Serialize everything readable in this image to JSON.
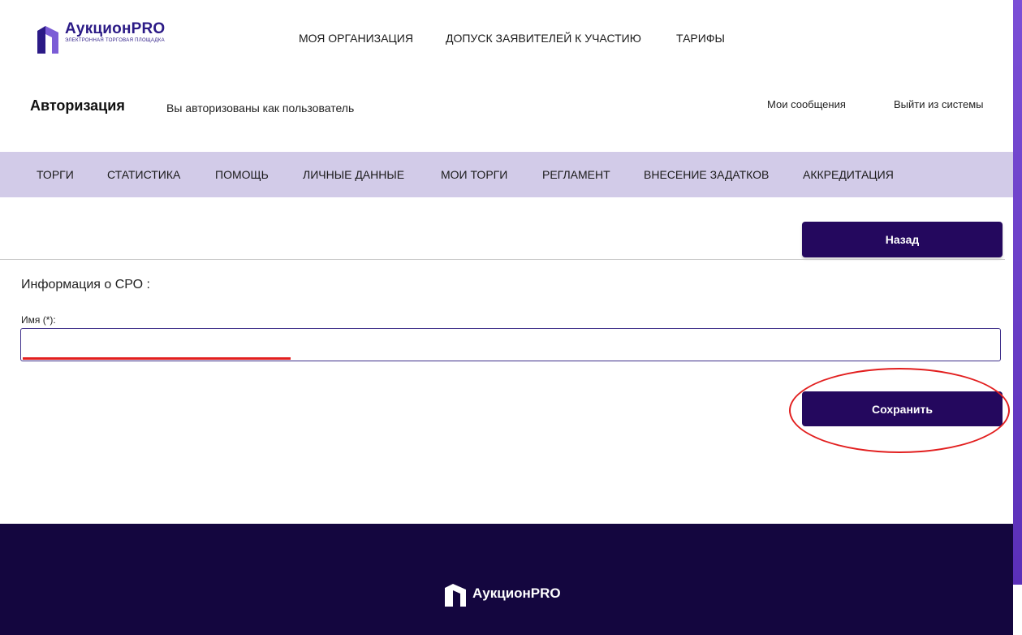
{
  "brand": {
    "name": "АукционPRO",
    "subtitle": "ЭЛЕКТРОННАЯ ТОРГОВАЯ ПЛОЩАДКА",
    "primary_color": "#24085e",
    "menu_bg_color": "#d2cbe8",
    "footer_color": "#14063f"
  },
  "top_nav": {
    "links": [
      "МОЯ ОРГАНИЗАЦИЯ",
      "ДОПУСК ЗАЯВИТЕЛЕЙ К УЧАСТИЮ",
      "ТАРИФЫ"
    ]
  },
  "auth": {
    "title": "Авторизация",
    "status_text": "Вы авторизованы как пользователь",
    "messages_link": "Мои сообщения",
    "logout_link": "Выйти из системы"
  },
  "menu": {
    "items": [
      "ТОРГИ",
      "СТАТИСТИКА",
      "ПОМОЩЬ",
      "ЛИЧНЫЕ ДАННЫЕ",
      "МОИ ТОРГИ",
      "РЕГЛАМЕНТ",
      "ВНЕСЕНИЕ ЗАДАТКОВ",
      "АККРЕДИТАЦИЯ"
    ]
  },
  "form": {
    "back_label": "Назад",
    "section_title": "Информация о СРО :",
    "name_label": "Имя (*):",
    "name_value": "",
    "save_label": "Сохранить"
  },
  "footer": {
    "brand_name": "АукционPRO"
  }
}
